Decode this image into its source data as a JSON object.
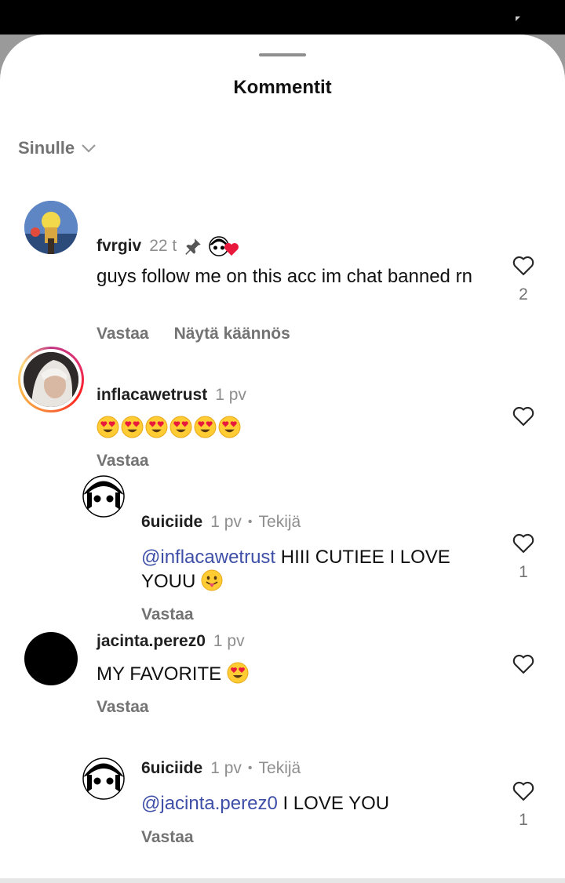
{
  "sheet": {
    "title": "Kommentit",
    "sort_label": "Sinulle"
  },
  "comments": [
    {
      "username": "fvrgiv",
      "time": "22 t",
      "pinned": true,
      "text": "guys follow me on this acc im chat banned rn",
      "likes": "2",
      "reply_label": "Vastaa",
      "translate_label": "Näytä käännös"
    },
    {
      "username": "inflacawetrust",
      "time": "1 pv",
      "emoji_count": 6,
      "reply_label": "Vastaa"
    },
    {
      "username": "6uiciide",
      "time": "1 pv",
      "author_label": "Tekijä",
      "mention": "@inflacawetrust",
      "text": "HIII CUTIEE I LOVE YOUU",
      "likes": "1",
      "reply_label": "Vastaa"
    },
    {
      "username": "jacinta.perez0",
      "time": "1 pv",
      "text": "MY FAVORITE",
      "reply_label": "Vastaa"
    },
    {
      "username": "6uiciide",
      "time": "1 pv",
      "author_label": "Tekijä",
      "mention": "@jacinta.perez0",
      "text": "I LOVE YOU",
      "likes": "1",
      "reply_label": "Vastaa"
    }
  ],
  "icons": {
    "like": "heart-outline-icon",
    "pin": "pin-icon",
    "sort": "chevron-down-icon"
  }
}
